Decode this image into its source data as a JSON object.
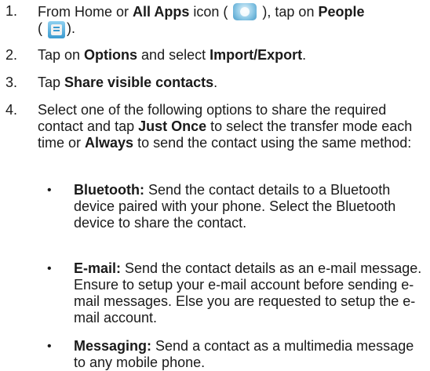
{
  "steps": [
    {
      "num": "1.",
      "t1": "From Home or ",
      "b1": "All Apps",
      "t2": " icon ( ",
      "t3": " ), tap on ",
      "b2": "People",
      "t4": "( ",
      "t5": ")."
    },
    {
      "num": "2.",
      "t1": "Tap on ",
      "b1": "Options",
      "t2": " and select ",
      "b2": "Import/Export",
      "t3": "."
    },
    {
      "num": "3.",
      "t1": "Tap ",
      "b1": "Share visible contacts",
      "t2": "."
    },
    {
      "num": "4.",
      "t1": "Select one of the following options to share the required contact and tap ",
      "b1": "Just Once",
      "t2": " to select the transfer mode each time or ",
      "b2": "Always",
      "t3": " to send the contact using the same method:"
    }
  ],
  "options": [
    {
      "bullet": "•",
      "label": "Bluetooth:",
      "text": " Send the contact details to a Bluetooth device paired with your phone. Select the Bluetooth device to share the contact."
    },
    {
      "bullet": "•",
      "label": "E-mail:",
      "text": " Send the contact details as an e-mail message. Ensure to setup your e-mail account before sending e-mail messages. Else you are requested to setup the e-mail account."
    },
    {
      "bullet": "•",
      "label": "Messaging:",
      "text": " Send a contact as a multimedia message to any mobile phone."
    }
  ],
  "icons": {
    "all_apps": "all-apps-icon",
    "people": "people-icon"
  }
}
